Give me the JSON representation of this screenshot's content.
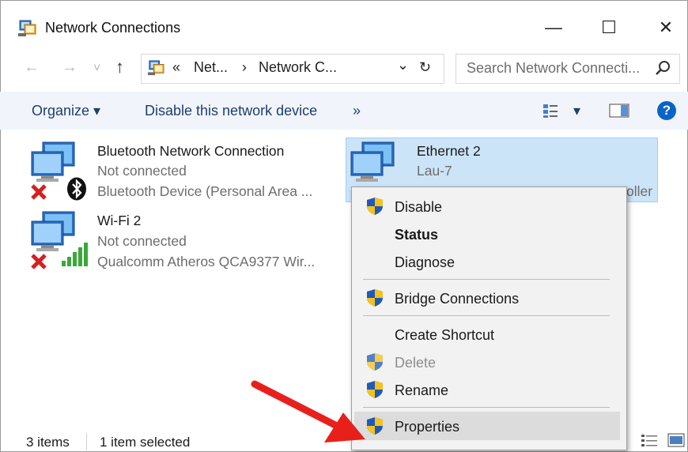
{
  "window": {
    "title": "Network Connections",
    "minimize": "—",
    "maximize": "☐",
    "close": "✕"
  },
  "navigation": {
    "back": "←",
    "forward": "→",
    "recent": "˅",
    "up": "↑",
    "address_prefix": "«",
    "address_part1": "Net...",
    "address_sep": "›",
    "address_part2": "Network C...",
    "dropdown": "⌄",
    "refresh": "↻",
    "search_placeholder": "Search Network Connecti..."
  },
  "commands": {
    "organize": "Organize ▾",
    "disable_device": "Disable this network device",
    "more": "»",
    "view_dropdown": "▾",
    "help": "?"
  },
  "items": [
    {
      "name": "Bluetooth Network Connection",
      "status": "Not connected",
      "device": "Bluetooth Device (Personal Area ...",
      "badge": "bluetooth",
      "error": true
    },
    {
      "name": "Wi-Fi 2",
      "status": "Not connected",
      "device": "Qualcomm Atheros QCA9377 Wir...",
      "badge": "signal",
      "error": true
    },
    {
      "name": "Ethernet 2",
      "status": "Lau-7",
      "device_visible": "oller",
      "selected": true
    }
  ],
  "context_menu": {
    "items": [
      {
        "label": "Disable",
        "shield": true,
        "style": "normal"
      },
      {
        "label": "Status",
        "shield": false,
        "style": "bold"
      },
      {
        "label": "Diagnose",
        "shield": false,
        "style": "normal"
      },
      {
        "label": "Bridge Connections",
        "shield": true,
        "style": "normal"
      },
      {
        "label": "Create Shortcut",
        "shield": false,
        "style": "normal"
      },
      {
        "label": "Delete",
        "shield": true,
        "style": "disabled"
      },
      {
        "label": "Rename",
        "shield": true,
        "style": "normal"
      },
      {
        "label": "Properties",
        "shield": true,
        "style": "highlighted"
      }
    ]
  },
  "status_bar": {
    "count": "3 items",
    "selected": "1 item selected"
  },
  "colors": {
    "accent": "#0078d7",
    "selection": "#cce4f7",
    "arrow": "#e8201c",
    "shield_blue": "#1f5ab8",
    "shield_yellow": "#f4c21b"
  }
}
